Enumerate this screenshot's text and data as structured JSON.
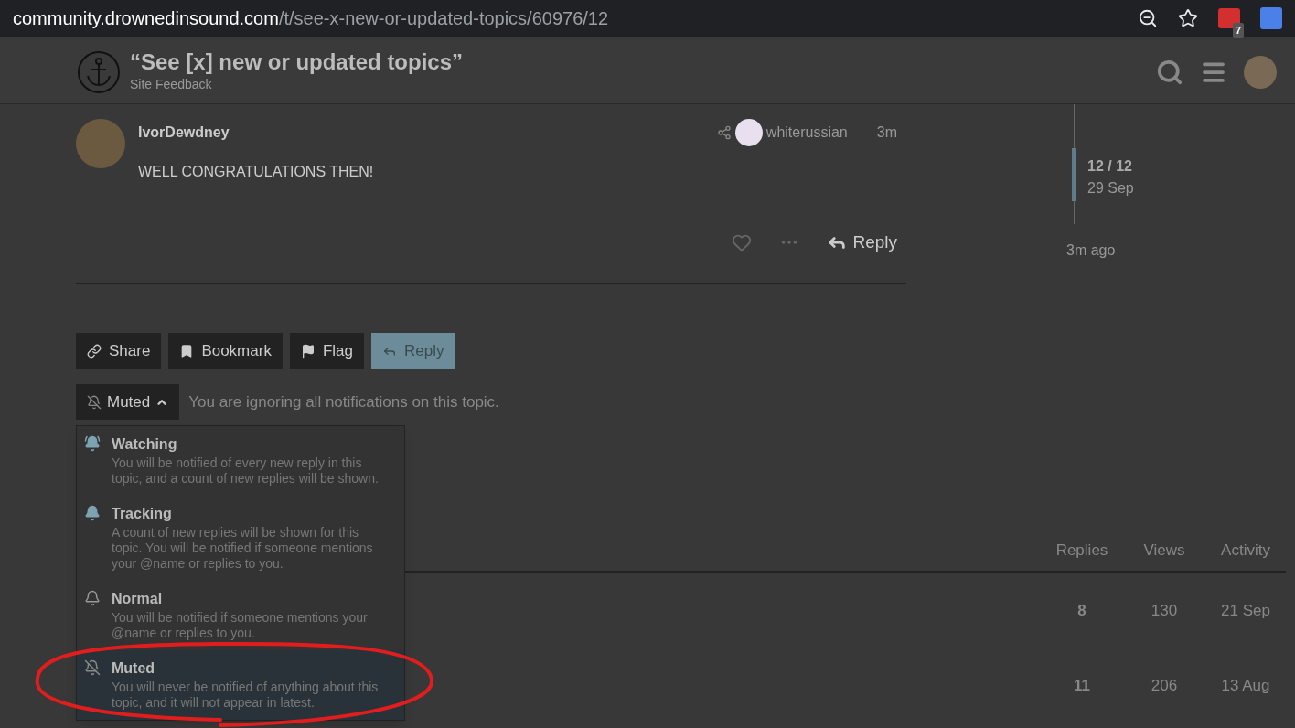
{
  "browser": {
    "url_host": "community.drownedinsound.com",
    "url_path": "/t/see-x-new-or-updated-topics/60976/12",
    "extension_badge": "7"
  },
  "header": {
    "title": "“See [x] new or updated topics”",
    "category": "Site Feedback"
  },
  "post": {
    "username": "IvorDewdney",
    "reply_to": "whiterussian",
    "age": "3m",
    "body": "WELL CONGRATULATIONS THEN!",
    "reply_label": "Reply"
  },
  "timeline": {
    "position": "12 / 12",
    "date": "29 Sep",
    "last": "3m ago"
  },
  "actions": [
    {
      "kind": "share",
      "label": "Share",
      "primary": false
    },
    {
      "kind": "bookmark",
      "label": "Bookmark",
      "primary": false
    },
    {
      "kind": "flag",
      "label": "Flag",
      "primary": false
    },
    {
      "kind": "reply",
      "label": "Reply",
      "primary": true
    }
  ],
  "notifications": {
    "button": "Muted",
    "expanded": true,
    "status": "You are ignoring all notifications on this topic.",
    "options": [
      {
        "kind": "watching",
        "title": "Watching",
        "description": "You will be notified of every new reply in this topic, and a count of new replies will be shown.",
        "selected": false
      },
      {
        "kind": "tracking",
        "title": "Tracking",
        "description": "A count of new replies will be shown for this topic. You will be notified if someone mentions your @name or replies to you.",
        "selected": false
      },
      {
        "kind": "normal",
        "title": "Normal",
        "description": "You will be notified if someone mentions your @name or replies to you.",
        "selected": false
      },
      {
        "kind": "muted",
        "title": "Muted",
        "description": "You will never be notified of anything about this topic, and it will not appear in latest.",
        "selected": true
      }
    ]
  },
  "table": {
    "columns": [
      "Replies",
      "Views",
      "Activity"
    ],
    "rows": [
      {
        "replies": "8",
        "views": "130",
        "activity": "21 Sep"
      },
      {
        "replies": "11",
        "views": "206",
        "activity": "13 Aug"
      }
    ]
  }
}
